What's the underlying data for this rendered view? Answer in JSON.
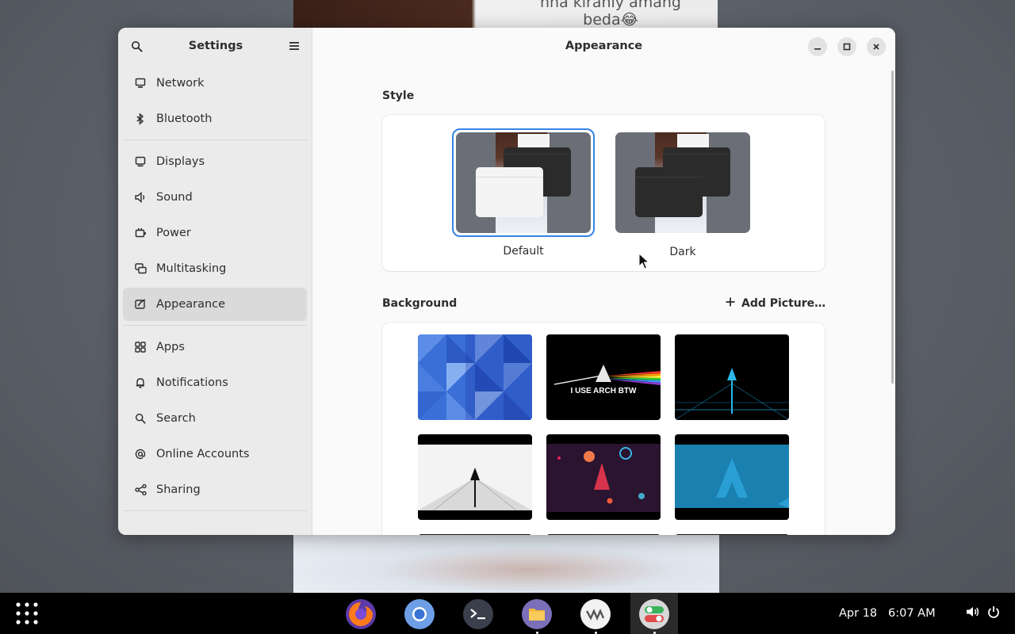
{
  "desktop": {
    "meme_text_line1": "nna kiranly amang",
    "meme_text_line2": "beda😂"
  },
  "sidebar": {
    "title": "Settings",
    "search_icon": "search-icon",
    "menu_icon": "hamburger-menu-icon",
    "groups": [
      [
        {
          "label": "Network",
          "icon": "network-icon"
        },
        {
          "label": "Bluetooth",
          "icon": "bluetooth-icon"
        }
      ],
      [
        {
          "label": "Displays",
          "icon": "display-icon"
        },
        {
          "label": "Sound",
          "icon": "speaker-icon"
        },
        {
          "label": "Power",
          "icon": "power-icon"
        },
        {
          "label": "Multitasking",
          "icon": "multitasking-icon"
        },
        {
          "label": "Appearance",
          "icon": "appearance-icon",
          "active": true
        }
      ],
      [
        {
          "label": "Apps",
          "icon": "apps-icon"
        },
        {
          "label": "Notifications",
          "icon": "bell-icon"
        },
        {
          "label": "Search",
          "icon": "search-icon"
        },
        {
          "label": "Online Accounts",
          "icon": "at-sign-icon"
        },
        {
          "label": "Sharing",
          "icon": "share-icon"
        }
      ]
    ]
  },
  "content": {
    "title": "Appearance",
    "style_section": {
      "label": "Style",
      "options": [
        {
          "label": "Default",
          "selected": true
        },
        {
          "label": "Dark",
          "selected": false
        }
      ]
    },
    "background_section": {
      "label": "Background",
      "add_picture_label": "Add Picture…",
      "arch_wallpaper_text": "I USE ARCH BTW"
    }
  },
  "window_controls": [
    "minimize-icon",
    "maximize-icon",
    "close-icon"
  ],
  "taskbar": {
    "date": "Apr 18",
    "time": "6:07 AM",
    "dock": [
      "Firefox",
      "Chromium",
      "Terminal",
      "Files",
      "VMware",
      "Settings"
    ]
  },
  "colors": {
    "accent": "#3584e4",
    "sidebar_bg": "#ebebeb",
    "content_bg": "#fafafa",
    "taskbar_bg": "#000000"
  }
}
